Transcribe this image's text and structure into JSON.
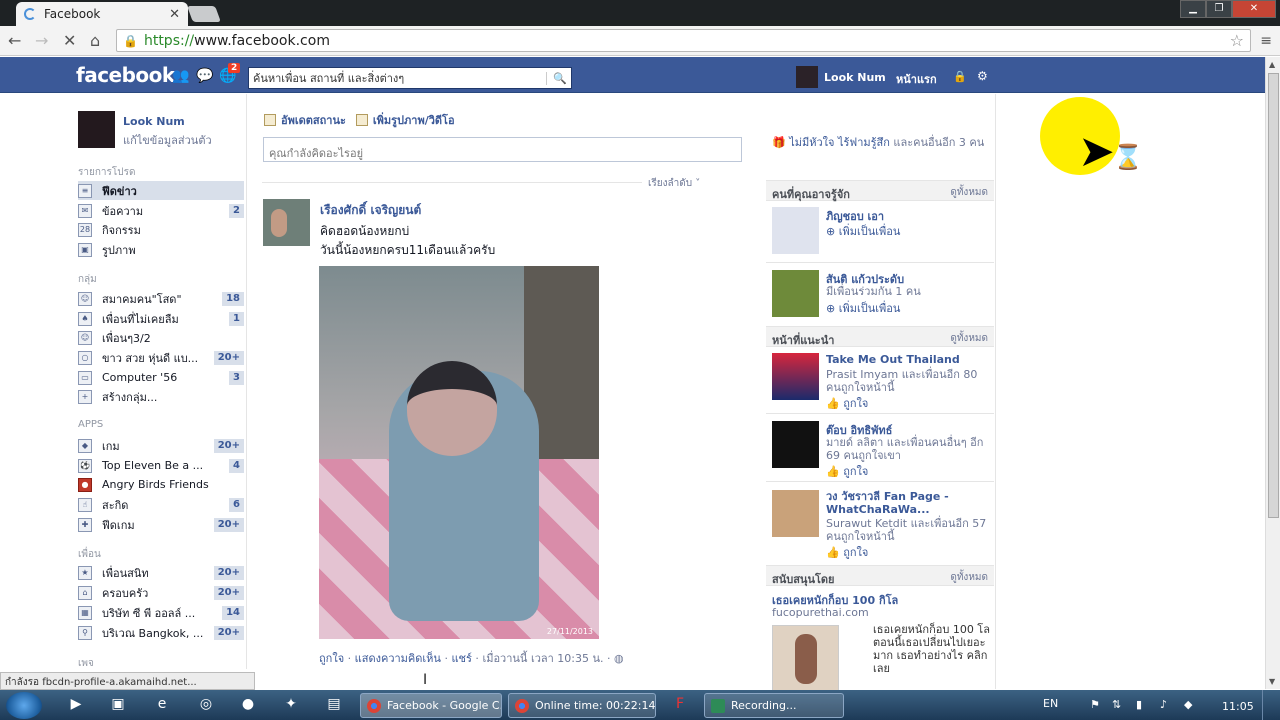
{
  "browser": {
    "tab_title": "Facebook",
    "tab_close": "✕",
    "url_scheme": "https://",
    "url_rest": "www.facebook.com",
    "back": "←",
    "forward": "→",
    "stop": "✕",
    "home": "⌂",
    "star": "☆",
    "menu": "≡",
    "minimize": "▁",
    "maximize": "❐",
    "close": "✕"
  },
  "fb": {
    "logo": "facebook",
    "notif_count": "2",
    "search_placeholder": "ค้นหาเพื่อน สถานที่ และสิ่งต่างๆ",
    "user_name": "Look Num",
    "home_link": "หน้าแรก"
  },
  "left": {
    "profile_name": "Look Num",
    "profile_edit": "แก้ไขข้อมูลส่วนตัว",
    "favorites_header": "รายการโปรด",
    "favorites": [
      {
        "label": "ฟีดข่าว",
        "count": ""
      },
      {
        "label": "ข้อความ",
        "count": "2"
      },
      {
        "label": "กิจกรรม",
        "count": ""
      },
      {
        "label": "รูปภาพ",
        "count": ""
      }
    ],
    "groups_header": "กลุ่ม",
    "groups": [
      {
        "label": "สมาคมคน\"โสด\"",
        "count": "18"
      },
      {
        "label": "เพื่อนที่ไม่เคยลืม",
        "count": "1"
      },
      {
        "label": "เพื่อนๆ3/2",
        "count": ""
      },
      {
        "label": "ขาว สวย หุ่นดี แบ...",
        "count": "20+"
      },
      {
        "label": "Computer '56",
        "count": "3"
      },
      {
        "label": "สร้างกลุ่ม...",
        "count": ""
      }
    ],
    "apps_header": "APPS",
    "apps": [
      {
        "label": "เกม",
        "count": "20+"
      },
      {
        "label": "Top Eleven Be a ...",
        "count": "4"
      },
      {
        "label": "Angry Birds Friends",
        "count": ""
      },
      {
        "label": "สะกิด",
        "count": "6"
      },
      {
        "label": "ฟีดเกม",
        "count": "20+"
      }
    ],
    "friends_header": "เพื่อน",
    "friends": [
      {
        "label": "เพื่อนสนิท",
        "count": "20+"
      },
      {
        "label": "ครอบครัว",
        "count": "20+"
      },
      {
        "label": "บริษัท ซี พี ออลล์ ...",
        "count": "14"
      },
      {
        "label": "บริเวณ Bangkok, ...",
        "count": "20+"
      }
    ],
    "pages_header": "เพจ"
  },
  "center": {
    "update_status": "อัพเดตสถานะ",
    "add_photo": "เพิ่มรูปภาพ/วิดีโอ",
    "composer_placeholder": "คุณกำลังคิดอะไรอยู่",
    "sort_label": "เรียงลำดับ ˅",
    "post": {
      "author": "เรืองศักดิ์ เจริญยนต์",
      "line1": "คิดฮอดน้องหยกบ่",
      "line2": "วันนี้น้องหยกครบ11เดือนแล้วครับ",
      "photo_stamp": "27/11/2013",
      "like": "ถูกใจ",
      "comment": "แสดงความคิดเห็น",
      "share": "แชร์",
      "time": "เมื่อวานนี้ เวลา 10:35 น."
    }
  },
  "right": {
    "ticker_link": "ไม่มีหัวใจ ไร้ฟามรู้สึก",
    "ticker_rest": "และคนอื่นอีก 3 คน",
    "pymk_header": "คนที่คุณอาจรู้จัก",
    "see_all": "ดูทั้งหมด",
    "pymk": [
      {
        "name": "ภิญชอบ เอา",
        "sub": "",
        "action": "เพิ่มเป็นเพื่อน"
      },
      {
        "name": "สันติ แก้วประดับ",
        "sub": "มีเพื่อนร่วมกัน 1 คน",
        "action": "เพิ่มเป็นเพื่อน"
      }
    ],
    "pages_header": "หน้าที่แนะนำ",
    "pages": [
      {
        "name": "Take Me Out Thailand",
        "sub": "Prasit Imyam และเพื่อนอีก 80 คนถูกใจหน้านี้",
        "action": "ถูกใจ"
      },
      {
        "name": "ต๊อบ อิทธิพัทธ์",
        "sub": "มายด์ ลลิตา และเพื่อนคนอื่นๆ อีก 69 คนถูกใจเขา",
        "action": "ถูกใจ"
      },
      {
        "name": "วง วัชราวลี Fan Page - WhatChaRaWa...",
        "sub": "Surawut Ketdit และเพื่อนอีก 57 คนถูกใจหน้านี้",
        "action": "ถูกใจ"
      }
    ],
    "sponsored_header": "สนับสนุนโดย",
    "ad_title": "เธอเคยหนักก็อบ 100 กิโล",
    "ad_url": "fucopurethai.com",
    "ad_text": "เธอเคยหนักก็อบ 100 โล ตอนนี้เธอเปลี่ยนไปเยอะมาก เธอทำอย่างไร คลิกเลย"
  },
  "status_bar": "กำลังรอ fbcdn-profile-a.akamaihd.net...",
  "taskbar": {
    "items": [
      {
        "label": "Facebook - Google C..."
      },
      {
        "label": "Online time: 00:22:14..."
      },
      {
        "label": "Recording..."
      }
    ],
    "lang": "EN",
    "clock": "11:05"
  }
}
